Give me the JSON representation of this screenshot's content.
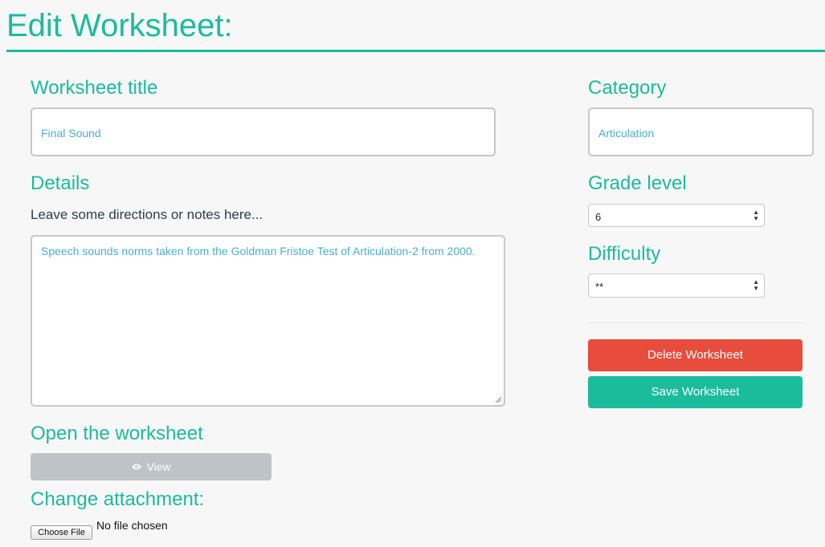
{
  "header": {
    "title": "Edit Worksheet:"
  },
  "form": {
    "title_label": "Worksheet title",
    "title_value": "Final Sound",
    "details_label": "Details",
    "details_hint": "Leave some directions or notes here...",
    "details_value": "Speech sounds norms taken from the Goldman Fristoe Test of Articulation-2 from 2000.",
    "open_label": "Open the worksheet",
    "view_button": "View",
    "attachment_label": "Change attachment:",
    "choose_file_button": "Choose File",
    "file_status": "No file chosen"
  },
  "sidebar": {
    "category_label": "Category",
    "category_value": "Articulation",
    "grade_label": "Grade level",
    "grade_value": "6",
    "difficulty_label": "Difficulty",
    "difficulty_value": "**",
    "delete_button": "Delete Worksheet",
    "save_button": "Save Worksheet"
  },
  "colors": {
    "accent": "#1abc9c",
    "danger": "#e74c3c",
    "input_text": "#48b0d6",
    "disabled": "#bdc3c7"
  }
}
